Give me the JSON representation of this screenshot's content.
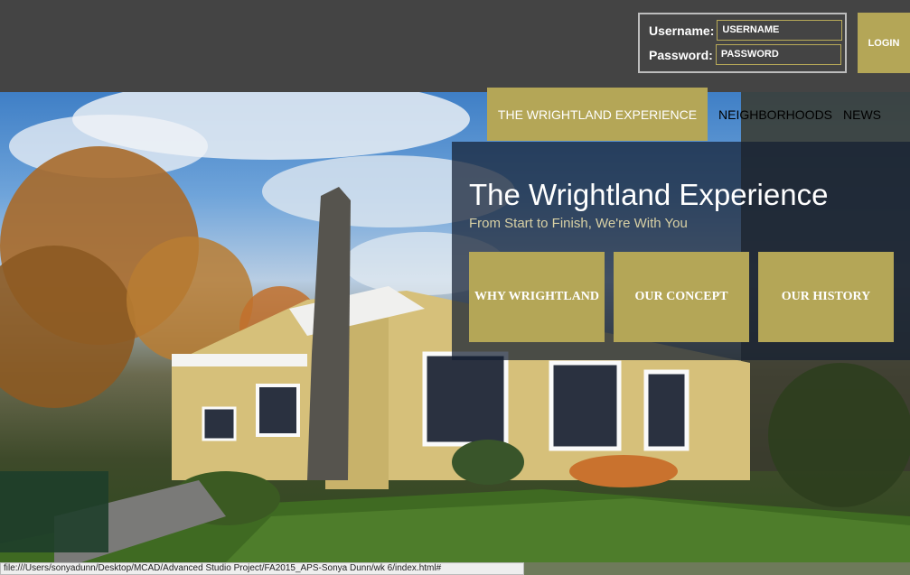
{
  "login": {
    "username_label": "Username:",
    "username_value": "USERNAME",
    "password_label": "Password:",
    "password_value": "PASSWORD",
    "button_label": "LOGIN"
  },
  "nav": {
    "items": [
      {
        "label": "THE WRIGHTLAND EXPERIENCE",
        "active": true
      },
      {
        "label": "NEIGHBORHOODS"
      },
      {
        "label": "NEWS"
      }
    ]
  },
  "hero": {
    "title": "The Wrightland Experience",
    "subtitle": "From Start to Finish, We're With You",
    "tiles": [
      "WHY WRIGHTLAND",
      "OUR CONCEPT",
      "OUR HISTORY"
    ]
  },
  "status": {
    "url": "file:///Users/sonyadunn/Desktop/MCAD/Advanced Studio Project/FA2015_APS-Sonya Dunn/wk 6/index.html#"
  },
  "colors": {
    "header_bg": "#444444",
    "accent": "#b4a657",
    "panel": "#141e32"
  }
}
